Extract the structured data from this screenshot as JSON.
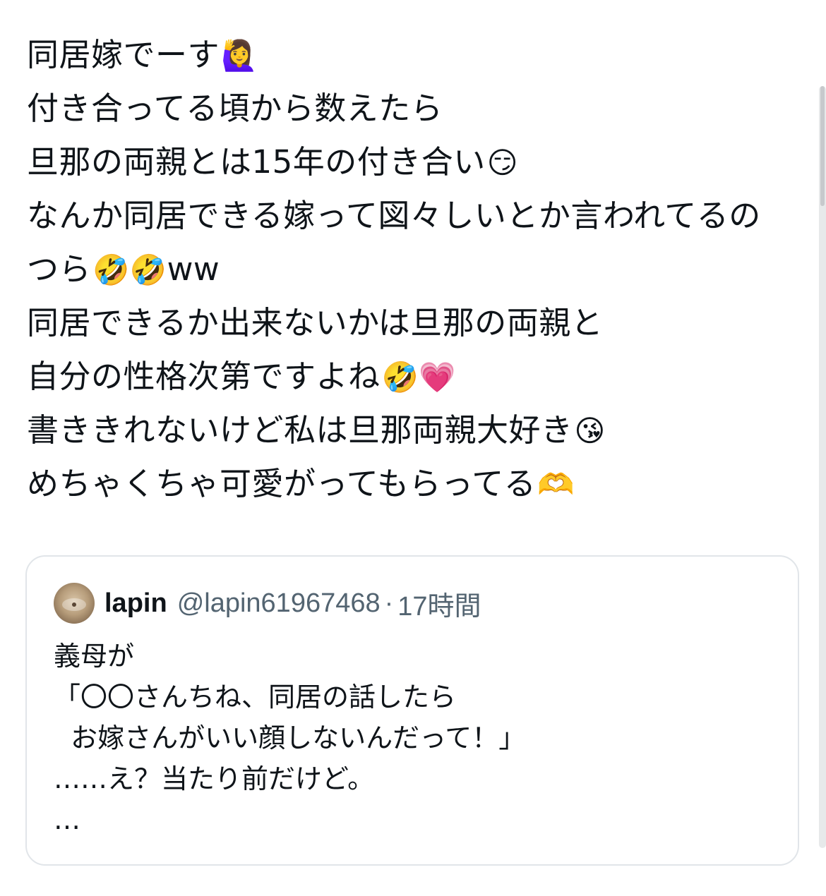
{
  "post": {
    "lines": [
      {
        "text": "同居嫁でーす",
        "emoji": "🙋‍♀️"
      },
      {
        "text": "付き合ってる頃から数えたら",
        "emoji": ""
      },
      {
        "text": "旦那の両親とは15年の付き合い",
        "emoji": "😏"
      },
      {
        "text": "なんか同居できる嫁って図々しいとか言われてるの",
        "emoji": ""
      },
      {
        "text": "つら",
        "emoji": "🤣🤣",
        "suffix": "ww"
      },
      {
        "text": "同居できるか出来ないかは旦那の両親と",
        "emoji": ""
      },
      {
        "text": "自分の性格次第ですよね",
        "emoji": "🤣💗"
      },
      {
        "text": "書ききれないけど私は旦那両親大好き",
        "emoji": "😘"
      },
      {
        "text": "めちゃくちゃ可愛がってもらってる",
        "emoji": "🫶"
      }
    ]
  },
  "quote": {
    "display_name": "lapin",
    "handle": "@lapin61967468",
    "separator": "·",
    "time": "17時間",
    "lines": [
      "義母が",
      "「〇〇さんちね、同居の話したら",
      "  お嫁さんがいい顔しないんだって！」",
      "……え？当たり前だけど。",
      "…"
    ]
  }
}
